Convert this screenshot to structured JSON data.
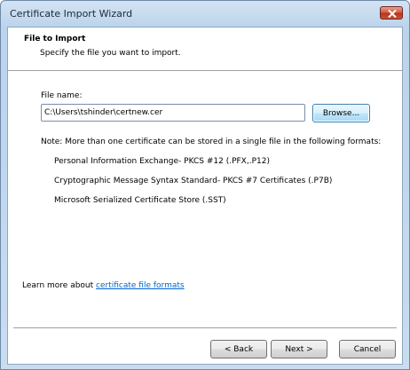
{
  "window": {
    "title": "Certificate Import Wizard"
  },
  "header": {
    "title": "File to Import",
    "subtitle": "Specify the file you want to import."
  },
  "file": {
    "label": "File name:",
    "value": "C:\\Users\\tshinder\\certnew.cer",
    "browse_label": "Browse..."
  },
  "note": {
    "text": "Note:  More than one certificate can be stored in a single file in the following formats:",
    "formats": [
      "Personal Information Exchange- PKCS #12 (.PFX,.P12)",
      "Cryptographic Message Syntax Standard- PKCS #7 Certificates (.P7B)",
      "Microsoft Serialized Certificate Store (.SST)"
    ]
  },
  "learn_more": {
    "prefix": "Learn more about ",
    "link": "certificate file formats"
  },
  "footer": {
    "back_label": "< Back",
    "next_label": "Next >",
    "cancel_label": "Cancel"
  },
  "colors": {
    "link": "#0066cc",
    "close_button": "#c9522f",
    "title_bar": "#bcd3ec"
  }
}
